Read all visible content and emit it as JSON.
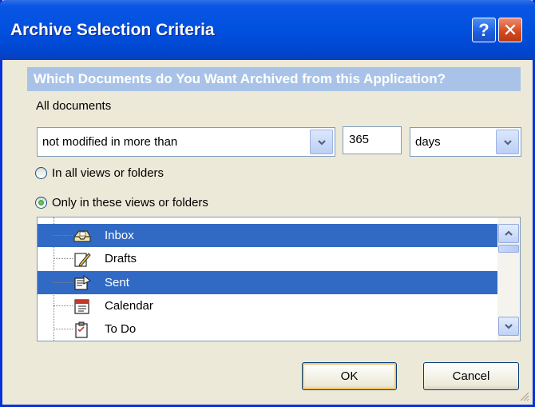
{
  "window": {
    "title": "Archive Selection Criteria",
    "help_glyph": "?",
    "close_glyph": "✕"
  },
  "header": {
    "text": "Which Documents do You Want Archived from this Application?"
  },
  "criteria": {
    "scope_label": "All documents",
    "condition_value": "not modified in more than",
    "count_value": "365",
    "units_value": "days"
  },
  "radios": {
    "all_views_label": "In all views or folders",
    "only_these_label": "Only in these views or folders",
    "selected": "only_these"
  },
  "folders": {
    "items": [
      {
        "label": "Inbox",
        "icon": "inbox-icon",
        "selected": true
      },
      {
        "label": "Drafts",
        "icon": "drafts-icon",
        "selected": false
      },
      {
        "label": "Sent",
        "icon": "sent-icon",
        "selected": true
      },
      {
        "label": "Calendar",
        "icon": "calendar-icon",
        "selected": false
      },
      {
        "label": "To Do",
        "icon": "todo-icon",
        "selected": false
      }
    ]
  },
  "buttons": {
    "ok_label": "OK",
    "cancel_label": "Cancel"
  },
  "colors": {
    "titlebar": "#0050df",
    "selection": "#316ac5",
    "header_band": "#a9c3e8",
    "face": "#ece9d8"
  }
}
